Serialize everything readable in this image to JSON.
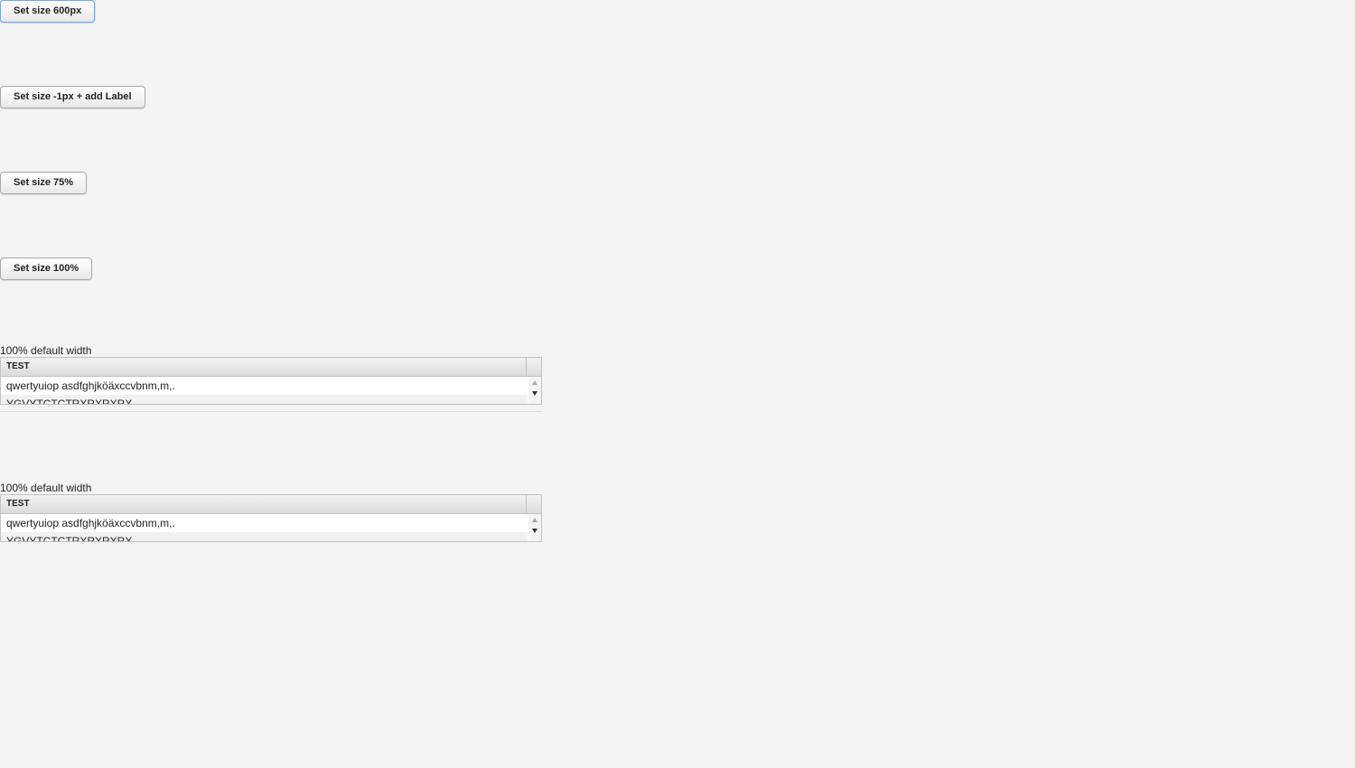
{
  "buttons": [
    {
      "label": "Set size 600px"
    },
    {
      "label": "Set size -1px + add Label"
    },
    {
      "label": "Set size 75%"
    },
    {
      "label": "Set size 100%"
    }
  ],
  "tables": [
    {
      "caption": "100% default width",
      "header": "TEST",
      "rows": [
        "qwertyuiop asdfghjköäxccvbnm,m,.",
        "YGVYTCTCTRXRXRXRX"
      ]
    },
    {
      "caption": "100% default width",
      "header": "TEST",
      "rows": [
        "qwertyuiop asdfghjköäxccvbnm,m,.",
        "YGVYTCTCTRXRXRXRX"
      ]
    }
  ]
}
